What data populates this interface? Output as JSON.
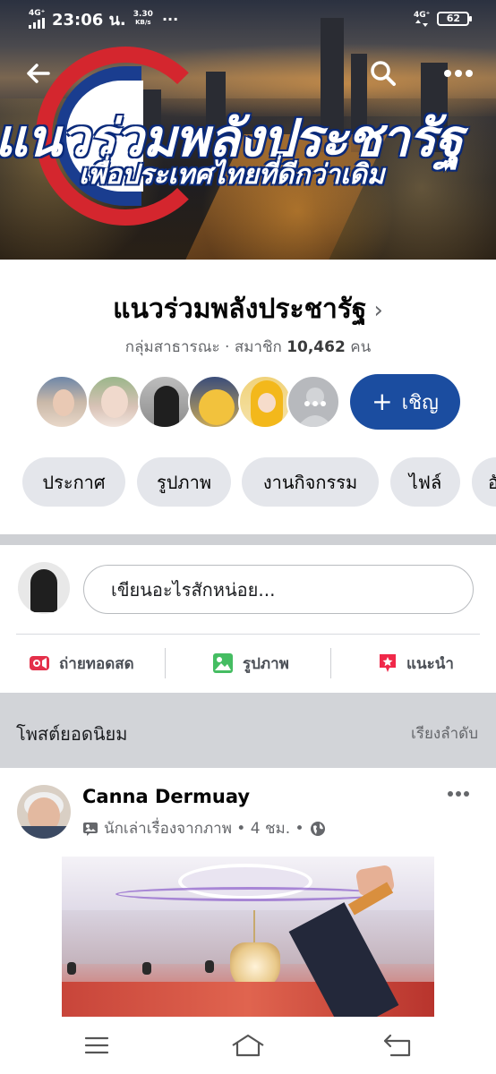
{
  "status_bar": {
    "network_left": "4G⁺",
    "time": "23:06 น.",
    "speed_value": "3.30",
    "speed_unit": "KB/s",
    "more": "···",
    "network_right": "4G⁺",
    "battery": "62"
  },
  "cover": {
    "title": "แนวร่วมพลังประชารัฐ",
    "subtitle": "เพื่อประเทศไทยที่ดีกว่าเดิม"
  },
  "top_nav": {
    "back_icon": "arrow-left-icon",
    "search_icon": "search-icon",
    "more_icon": "more-dots-icon"
  },
  "group": {
    "name": "แนวร่วมพลังประชารัฐ",
    "privacy": "กลุ่มสาธารณะ",
    "members_prefix": "สมาชิก",
    "members_count": "10,462",
    "members_suffix": "คน",
    "invite_label": "เชิญ"
  },
  "tabs": [
    {
      "label": "ประกาศ"
    },
    {
      "label": "รูปภาพ"
    },
    {
      "label": "งานกิจกรรม"
    },
    {
      "label": "ไฟล์"
    },
    {
      "label": "อั"
    }
  ],
  "composer": {
    "placeholder": "เขียนอะไรสักหน่อย..."
  },
  "actions": [
    {
      "label": "ถ่ายทอดสด",
      "icon": "live-video-icon",
      "color": "#e4304a"
    },
    {
      "label": "รูปภาพ",
      "icon": "photo-icon",
      "color": "#45bd62"
    },
    {
      "label": "แนะนำ",
      "icon": "recommend-icon",
      "color": "#f02849"
    }
  ],
  "popular": {
    "title": "โพสต์ยอดนิยม",
    "sort_label": "เรียงลำดับ"
  },
  "post": {
    "author": "Canna Dermuay",
    "meta": "นักเล่าเรื่องจากภาพ • 4 ชม. •"
  },
  "colors": {
    "accent": "#1b4da0",
    "chip_bg": "#e4e6eb",
    "secondary_text": "#65676b"
  }
}
